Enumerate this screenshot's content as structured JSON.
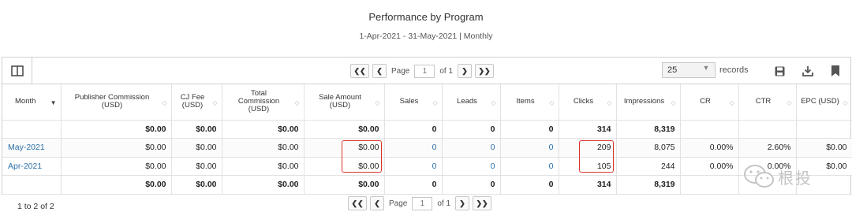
{
  "report": {
    "title": "Performance by Program",
    "subtitle": "1-Apr-2021 - 31-May-2021 | Monthly"
  },
  "pager": {
    "first_icon": "double-chevron-left-icon",
    "prev_icon": "chevron-left-icon",
    "next_icon": "chevron-right-icon",
    "last_icon": "double-chevron-right-icon",
    "page_label": "Page",
    "page_value": "1",
    "of_label": "of 1"
  },
  "records": {
    "value": "25",
    "label": "records"
  },
  "toolbar_icons": [
    "columns-icon",
    "save-icon",
    "download-icon",
    "bookmark-icon"
  ],
  "columns": [
    {
      "label": "Month",
      "sort": "desc"
    },
    {
      "label": "Publisher Commission\n(USD)",
      "sort": "none"
    },
    {
      "label": "CJ Fee\n(USD)",
      "sort": "none"
    },
    {
      "label": "Total\nCommission\n(USD)",
      "sort": "none"
    },
    {
      "label": "Sale Amount\n(USD)",
      "sort": "none"
    },
    {
      "label": "Sales",
      "sort": "none"
    },
    {
      "label": "Leads",
      "sort": "none"
    },
    {
      "label": "Items",
      "sort": "none"
    },
    {
      "label": "Clicks",
      "sort": "none"
    },
    {
      "label": "Impressions",
      "sort": "none"
    },
    {
      "label": "CR",
      "sort": "none"
    },
    {
      "label": "CTR",
      "sort": "none"
    },
    {
      "label": "EPC (USD)",
      "sort": "none"
    }
  ],
  "rows": {
    "top_total": [
      "",
      "$0.00",
      "$0.00",
      "$0.00",
      "$0.00",
      "0",
      "0",
      "0",
      "314",
      "8,319",
      "",
      "",
      ""
    ],
    "may": [
      "May-2021",
      "$0.00",
      "$0.00",
      "$0.00",
      "$0.00",
      "0",
      "0",
      "0",
      "209",
      "8,075",
      "0.00%",
      "2.60%",
      "$0.00"
    ],
    "apr": [
      "Apr-2021",
      "$0.00",
      "$0.00",
      "$0.00",
      "$0.00",
      "0",
      "0",
      "0",
      "105",
      "244",
      "0.00%",
      "0.00%",
      "$0.00"
    ],
    "bottom_total": [
      "",
      "$0.00",
      "$0.00",
      "$0.00",
      "$0.00",
      "0",
      "0",
      "0",
      "314",
      "8,319",
      "",
      "",
      ""
    ]
  },
  "footer": {
    "count": "1 to 2 of 2"
  },
  "watermark": {
    "text": "根投",
    "icon": "wechat-icon"
  },
  "colors": {
    "link": "#2a6fa8",
    "highlight": "#d9342b",
    "border": "#d0d0d0"
  }
}
